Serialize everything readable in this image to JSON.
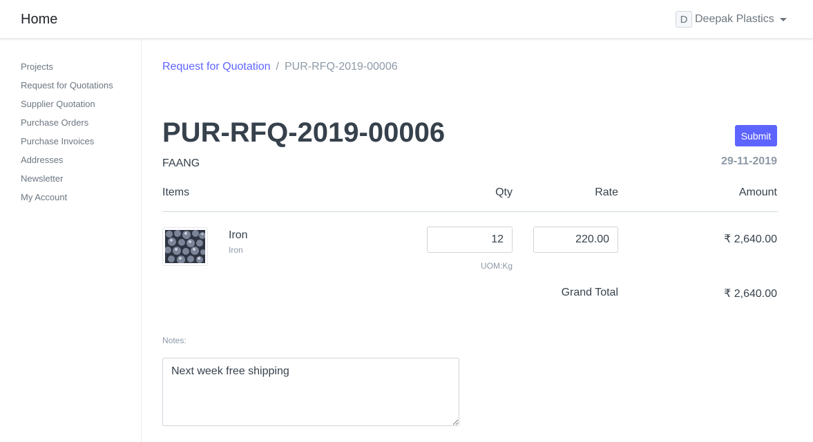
{
  "navbar": {
    "brand": "Home",
    "user": {
      "initial": "D",
      "name": "Deepak Plastics"
    }
  },
  "sidebar": {
    "items": [
      {
        "label": "Projects"
      },
      {
        "label": "Request for Quotations"
      },
      {
        "label": "Supplier Quotation"
      },
      {
        "label": "Purchase Orders"
      },
      {
        "label": "Purchase Invoices"
      },
      {
        "label": "Addresses"
      },
      {
        "label": "Newsletter"
      },
      {
        "label": "My Account"
      }
    ]
  },
  "breadcrumb": {
    "parent": "Request for Quotation",
    "separator": "/",
    "current": "PUR-RFQ-2019-00006"
  },
  "document": {
    "title": "PUR-RFQ-2019-00006",
    "supplier": "FAANG",
    "date": "29-11-2019",
    "submit_label": "Submit"
  },
  "table": {
    "headers": {
      "items": "Items",
      "qty": "Qty",
      "rate": "Rate",
      "amount": "Amount"
    },
    "rows": [
      {
        "item_name": "Iron",
        "item_code": "Iron",
        "qty": "12",
        "rate": "220.00",
        "uom": "UOM:Kg",
        "amount": "₹ 2,640.00"
      }
    ],
    "grand_total_label": "Grand Total",
    "grand_total": "₹ 2,640.00"
  },
  "notes": {
    "label": "Notes:",
    "value": "Next week free shipping"
  },
  "colors": {
    "accent": "#5e64ff",
    "text": "#36414c",
    "muted": "#8d99a6",
    "border": "#d1d8dd"
  }
}
